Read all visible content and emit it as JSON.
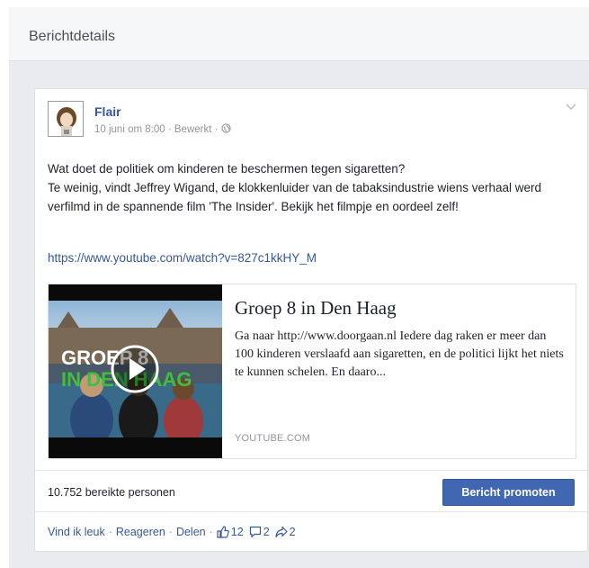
{
  "panel": {
    "title": "Berichtdetails"
  },
  "post": {
    "page_name": "Flair",
    "date": "10 juni om 8:00",
    "dot": "·",
    "edited": "Bewerkt",
    "text_lines": [
      "Wat doet de politiek om kinderen te beschermen tegen sigaretten?",
      "Te weinig, vindt Jeffrey Wigand, de klokkenluider van de tabaksindustrie wiens verhaal werd verfilmd in de spannende film 'The Insider'. Bekijk het filmpje en oordeel zelf!"
    ],
    "link": "https://www.youtube.com/watch?v=827c1kkHY_M",
    "attachment": {
      "thumbnail_text": [
        "GROEP 8",
        "IN DEN HAAG"
      ],
      "title": "Groep 8 in Den Haag",
      "description": "Ga naar http://www.doorgaan.nl Iedere dag raken er meer dan 100 kinderen verslaafd aan sigaretten, en de politici lijkt het niets te kunnen schelen. En daaro...",
      "domain": "YOUTUBE.COM"
    },
    "reach": "10.752 bereikte personen",
    "promote_label": "Bericht promoten",
    "actions": {
      "like": "Vind ik leuk",
      "comment": "Reageren",
      "share": "Delen",
      "sep": "·",
      "like_count": "12",
      "comment_count": "2",
      "share_count": "2"
    }
  },
  "colors": {
    "link": "#365899",
    "button": "#4267b2",
    "muted": "#90949c",
    "background": "#e9ebee"
  },
  "icons": [
    "chevron-down-icon",
    "globe-icon",
    "play-icon",
    "thumbs-up-icon",
    "comment-icon",
    "share-icon"
  ]
}
